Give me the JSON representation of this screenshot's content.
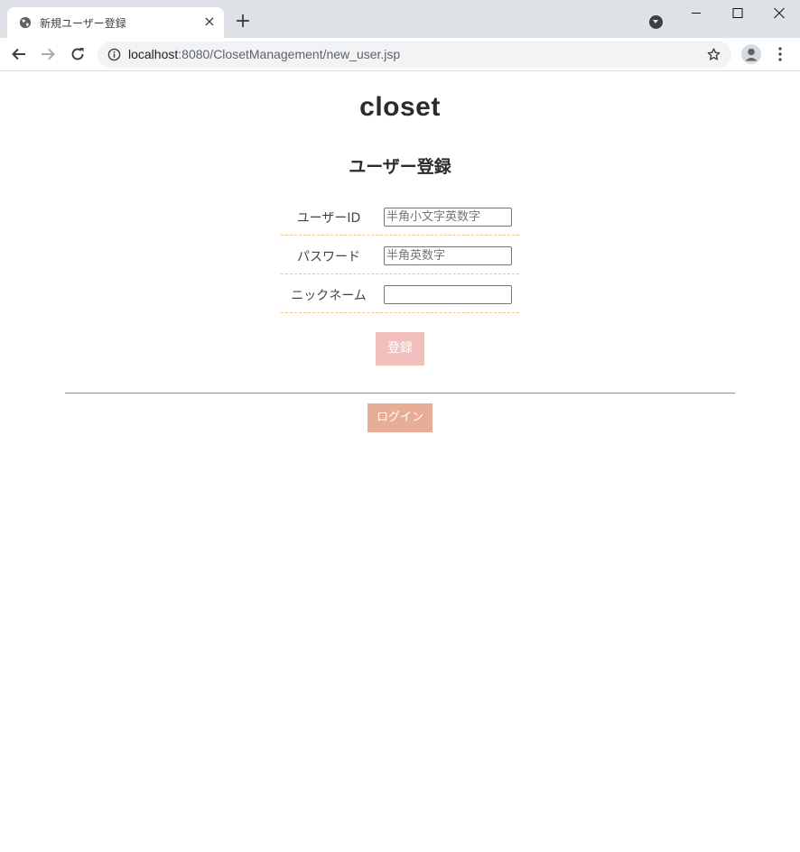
{
  "browser": {
    "tab": {
      "title": "新規ユーザー登録",
      "favicon": "globe-icon",
      "close_icon": "×"
    },
    "new_tab_icon": "+",
    "address_bar": {
      "host": "localhost",
      "path": ":8080/ClosetManagement/new_user.jsp"
    }
  },
  "page": {
    "logo": "closet",
    "heading": "ユーザー登録",
    "form": {
      "rows": [
        {
          "label": "ユーザーID",
          "placeholder": "半角小文字英数字",
          "value": ""
        },
        {
          "label": "パスワード",
          "placeholder": "半角英数字",
          "value": ""
        },
        {
          "label": "ニックネーム",
          "placeholder": "",
          "value": ""
        }
      ],
      "submit_label": "登録"
    },
    "login_label": "ログイン"
  },
  "colors": {
    "register_button": "#f2bfbd",
    "login_button": "#e8ad96",
    "row_divider": "#f0c48a",
    "tabbar": "#dee1e6"
  }
}
